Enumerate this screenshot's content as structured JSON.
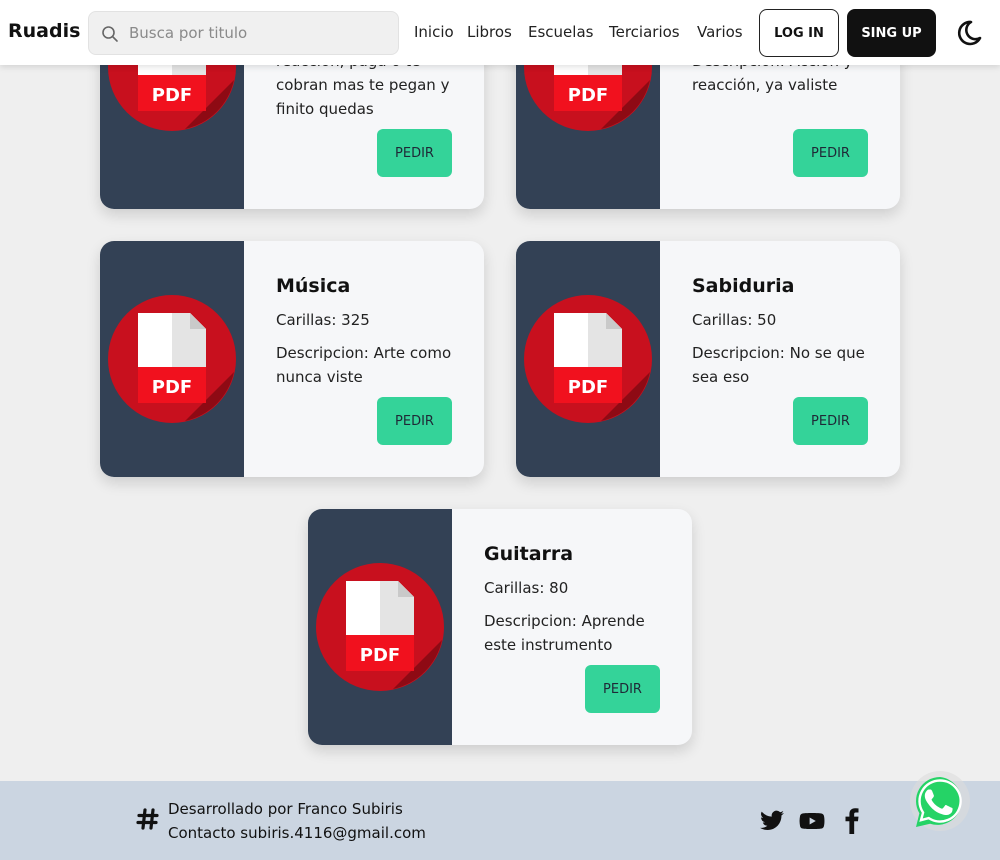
{
  "header": {
    "brand": "Ruadis",
    "search_placeholder": "Busca por titulo",
    "nav": [
      "Inicio",
      "Libros",
      "Escuelas",
      "Terciarios",
      "Varios"
    ],
    "login_label": "LOG IN",
    "signup_label": "SING UP"
  },
  "cards": [
    {
      "title": "",
      "pages": "",
      "desc": "reacción, paga o te cobran mas te pegan y finito quedas",
      "icon_label": "PDF",
      "button": "PEDIR"
    },
    {
      "title": "",
      "pages": "",
      "desc": "Descripcion: Acción y reacción, ya valiste",
      "icon_label": "PDF",
      "button": "PEDIR"
    },
    {
      "title": "Música",
      "pages": "Carillas: 325",
      "desc": "Descripcion: Arte como nunca viste",
      "icon_label": "PDF",
      "button": "PEDIR"
    },
    {
      "title": "Sabiduria",
      "pages": "Carillas: 50",
      "desc": "Descripcion: No se que sea eso",
      "icon_label": "PDF",
      "button": "PEDIR"
    },
    {
      "title": "Guitarra",
      "pages": "Carillas: 80",
      "desc": "Descripcion: Aprende este instrumento",
      "icon_label": "PDF",
      "button": "PEDIR"
    }
  ],
  "footer": {
    "developer": "Desarrollado por Franco Subiris",
    "contact": "Contacto subiris.4116@gmail.com",
    "social_icons": [
      "twitter-icon",
      "youtube-icon",
      "facebook-icon"
    ]
  },
  "colors": {
    "card_left": "#334155",
    "button": "#34d399",
    "footer": "#cbd5e1",
    "pdf_red": "#c8101e"
  }
}
